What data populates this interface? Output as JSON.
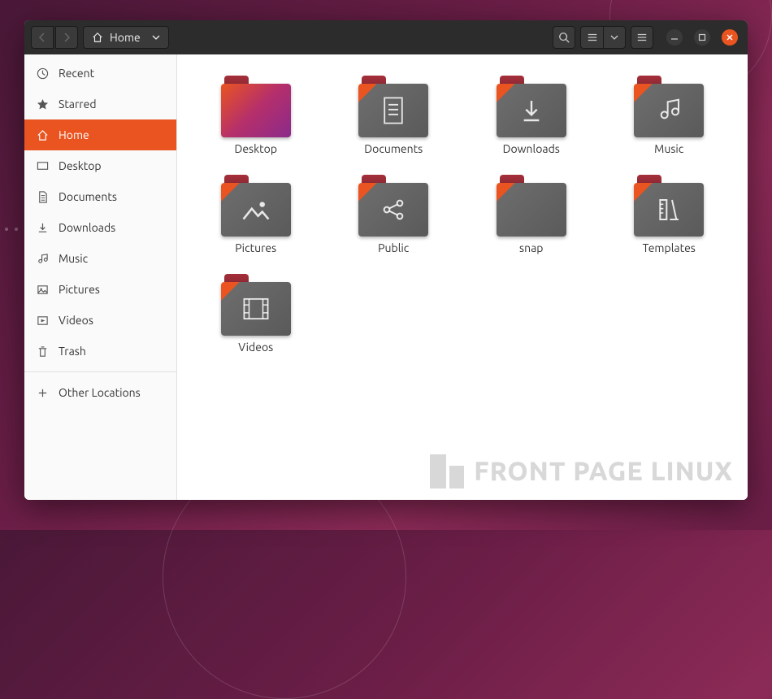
{
  "breadcrumb": {
    "label": "Home"
  },
  "sidebar": {
    "items": [
      {
        "label": "Recent",
        "icon": "clock",
        "active": false
      },
      {
        "label": "Starred",
        "icon": "star",
        "active": false
      },
      {
        "label": "Home",
        "icon": "home",
        "active": true
      },
      {
        "label": "Desktop",
        "icon": "desktop",
        "active": false
      },
      {
        "label": "Documents",
        "icon": "document",
        "active": false
      },
      {
        "label": "Downloads",
        "icon": "download",
        "active": false
      },
      {
        "label": "Music",
        "icon": "music",
        "active": false
      },
      {
        "label": "Pictures",
        "icon": "picture",
        "active": false
      },
      {
        "label": "Videos",
        "icon": "video",
        "active": false
      },
      {
        "label": "Trash",
        "icon": "trash",
        "active": false
      }
    ],
    "other_locations": "Other Locations"
  },
  "folders": [
    {
      "label": "Desktop",
      "glyph": "desktop"
    },
    {
      "label": "Documents",
      "glyph": "document"
    },
    {
      "label": "Downloads",
      "glyph": "download"
    },
    {
      "label": "Music",
      "glyph": "music"
    },
    {
      "label": "Pictures",
      "glyph": "picture"
    },
    {
      "label": "Public",
      "glyph": "share"
    },
    {
      "label": "snap",
      "glyph": "none"
    },
    {
      "label": "Templates",
      "glyph": "ruler"
    },
    {
      "label": "Videos",
      "glyph": "film"
    }
  ],
  "watermark": "FRONT PAGE LINUX"
}
